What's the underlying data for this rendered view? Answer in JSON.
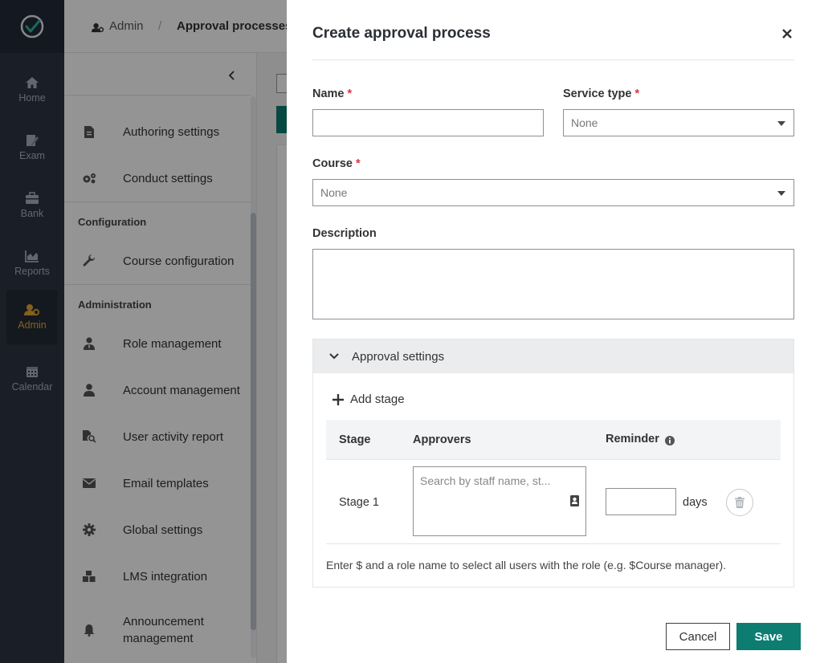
{
  "nav": {
    "items": [
      {
        "label": "Home",
        "icon": "home-icon"
      },
      {
        "label": "Exam",
        "icon": "exam-icon"
      },
      {
        "label": "Bank",
        "icon": "bank-icon"
      },
      {
        "label": "Reports",
        "icon": "reports-icon"
      },
      {
        "label": "Admin",
        "icon": "admin-icon",
        "active": true
      },
      {
        "label": "Calendar",
        "icon": "calendar-icon"
      }
    ],
    "active_color": "#e7a634"
  },
  "breadcrumb": {
    "root": "Admin",
    "separator": "/",
    "current": "Approval processes"
  },
  "sidebar": {
    "items": [
      {
        "label": "Authoring settings",
        "icon": "document-icon"
      },
      {
        "label": "Conduct settings",
        "icon": "gears-icon"
      },
      {
        "label": "Course configuration",
        "icon": "wrench-icon"
      },
      {
        "label": "Role management",
        "icon": "user-tie-icon"
      },
      {
        "label": "Account management",
        "icon": "user-icon"
      },
      {
        "label": "User activity report",
        "icon": "file-search-icon"
      },
      {
        "label": "Email templates",
        "icon": "envelope-icon"
      },
      {
        "label": "Global settings",
        "icon": "gear-icon"
      },
      {
        "label": "LMS integration",
        "icon": "boxes-icon"
      },
      {
        "label": "Announcement management",
        "icon": "bell-icon"
      }
    ],
    "sections": {
      "configuration": "Configuration",
      "administration": "Administration"
    }
  },
  "drawer": {
    "title": "Create approval process",
    "required_mark": "*",
    "fields": {
      "name": {
        "label": "Name",
        "value": ""
      },
      "service_type": {
        "label": "Service type",
        "value": "None"
      },
      "course": {
        "label": "Course",
        "value": "None"
      },
      "description": {
        "label": "Description",
        "value": ""
      }
    },
    "approval": {
      "title": "Approval settings",
      "add_stage": "Add stage",
      "columns": {
        "stage": "Stage",
        "approvers": "Approvers",
        "reminder": "Reminder"
      },
      "rows": [
        {
          "stage": "Stage 1",
          "approvers_placeholder": "Search by staff name, st...",
          "reminder": "",
          "unit": "days"
        }
      ],
      "hint": "Enter $ and a role name to select all users with the role (e.g. $Course manager)."
    },
    "buttons": {
      "cancel": "Cancel",
      "save": "Save"
    },
    "primary_color": "#0d7d72"
  }
}
